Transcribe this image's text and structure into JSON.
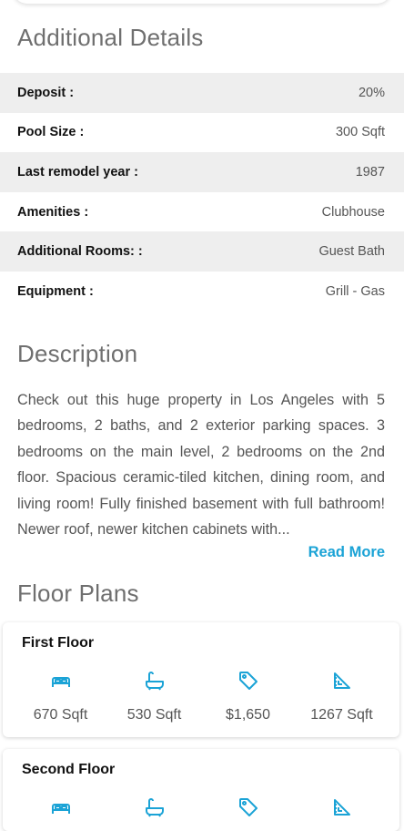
{
  "details": {
    "title": "Additional Details",
    "rows": [
      {
        "label": "Deposit :",
        "value": "20%"
      },
      {
        "label": "Pool Size :",
        "value": "300 Sqft"
      },
      {
        "label": "Last remodel year :",
        "value": "1987"
      },
      {
        "label": "Amenities :",
        "value": "Clubhouse"
      },
      {
        "label": "Additional Rooms: :",
        "value": "Guest Bath"
      },
      {
        "label": "Equipment :",
        "value": "Grill - Gas"
      }
    ]
  },
  "description": {
    "title": "Description",
    "text": "Check out this huge property in Los Angeles with 5 bedrooms, 2 baths, and 2 exterior parking spaces. 3 bedrooms on the main level, 2 bedrooms on the 2nd floor. Spacious ceramic-tiled kitchen, dining room, and living room! Fully finished basement with full bathroom! Newer roof, newer kitchen cabinets with...",
    "read_more": "Read More"
  },
  "floor_plans": {
    "title": "Floor Plans",
    "accent_color": "#1ba3d6",
    "floors": [
      {
        "name": "First Floor",
        "stats": [
          {
            "icon": "bed-icon",
            "value": "670 Sqft"
          },
          {
            "icon": "bathtub-icon",
            "value": "530 Sqft"
          },
          {
            "icon": "price-tag-icon",
            "value": "$1,650"
          },
          {
            "icon": "area-ruler-icon",
            "value": "1267 Sqft"
          }
        ]
      },
      {
        "name": "Second Floor",
        "stats": [
          {
            "icon": "bed-icon"
          },
          {
            "icon": "bathtub-icon"
          },
          {
            "icon": "price-tag-icon"
          },
          {
            "icon": "area-ruler-icon"
          }
        ]
      }
    ]
  }
}
